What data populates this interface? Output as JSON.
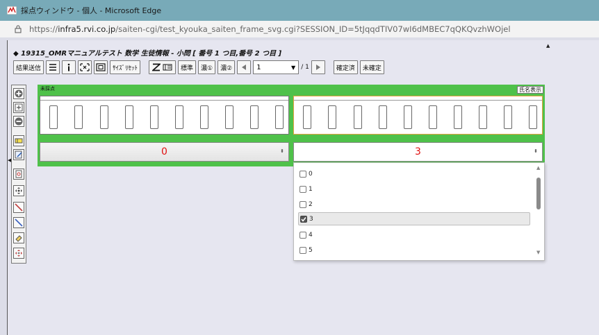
{
  "window": {
    "title": "採点ウィンドウ - 個人 - Microsoft Edge"
  },
  "address": {
    "prefix": "https://",
    "host": "infra5.rvi.co.jp",
    "path": "/saiten-cgi/test_kyouka_saiten_frame_svg.cgi?SESSION_ID=5tJqqdTIV07wI6dMBEC7qQKQvzhWOjel"
  },
  "heading": "◆ 19315_OMRマニュアルテスト 数学 生徒情報 - 小問 [ 番号 1 つ目,番号 2 つ目 ]",
  "toolbar": {
    "send_label": "結果送信",
    "size_reset_label": "ｻｲｽﾞﾘｾｯﾄ",
    "standard_label": "標準",
    "dark1_label": "濃①",
    "dark2_label": "濃②",
    "page_value": "1",
    "page_total": "/ 1",
    "confirmed_label": "確定済",
    "unconfirmed_label": "未確定"
  },
  "panel": {
    "status_label": "未採点",
    "name_button_label": "氏名表示",
    "left_value": "0",
    "right_value": "3",
    "value_color": "#e01010",
    "background_color": "#4fc14a"
  },
  "dropdown": {
    "options": [
      {
        "label": "0",
        "checked": false
      },
      {
        "label": "1",
        "checked": false
      },
      {
        "label": "2",
        "checked": false
      },
      {
        "label": "3",
        "checked": true
      },
      {
        "label": "4",
        "checked": false
      },
      {
        "label": "5",
        "checked": false
      }
    ]
  }
}
